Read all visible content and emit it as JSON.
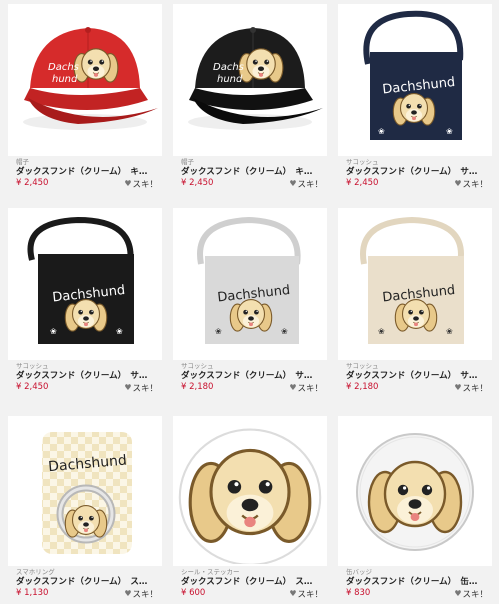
{
  "products": [
    {
      "category": "帽子",
      "title": "ダックスフンド（クリーム）　キ…",
      "price": "¥ 2,450",
      "like_label": "スキ！",
      "print_text": "Dachs hund",
      "item_color": "#d62b2b"
    },
    {
      "category": "帽子",
      "title": "ダックスフンド（クリーム）　キ…",
      "price": "¥ 2,450",
      "like_label": "スキ！",
      "print_text": "Dachs hund",
      "item_color": "#1c1c1c"
    },
    {
      "category": "サコッシュ",
      "title": "ダックスフンド（クリーム）　サ…",
      "price": "¥ 2,450",
      "like_label": "スキ！",
      "print_text": "Dachshund",
      "item_color": "#1f2a44"
    },
    {
      "category": "サコッシュ",
      "title": "ダックスフンド（クリーム）　サ…",
      "price": "¥ 2,450",
      "like_label": "スキ！",
      "print_text": "Dachshund",
      "item_color": "#1a1a1a"
    },
    {
      "category": "サコッシュ",
      "title": "ダックスフンド（クリーム）　サ…",
      "price": "¥ 2,180",
      "like_label": "スキ！",
      "print_text": "Dachshund",
      "item_color": "#d9d9d9"
    },
    {
      "category": "サコッシュ",
      "title": "ダックスフンド（クリーム）　サ…",
      "price": "¥ 2,180",
      "like_label": "スキ！",
      "print_text": "Dachshund",
      "item_color": "#eadfcb"
    },
    {
      "category": "スマホリング",
      "title": "ダックスフンド（クリーム）　ス…",
      "price": "¥ 1,130",
      "like_label": "スキ！",
      "print_text": "Dachshund",
      "item_color": "#f3ead0"
    },
    {
      "category": "シール・ステッカー",
      "title": "ダックスフンド（クリーム）　ス…",
      "price": "¥ 600",
      "like_label": "スキ！",
      "print_text": "",
      "item_color": "#ffffff"
    },
    {
      "category": "缶バッジ",
      "title": "ダックスフンド（クリーム）　缶…",
      "price": "¥ 830",
      "like_label": "スキ！",
      "print_text": "",
      "item_color": "#f4f4f4"
    }
  ],
  "icons": {
    "like": "heart-icon"
  },
  "colors": {
    "price": "#c8102e",
    "page_background": "#f2f2f2"
  }
}
